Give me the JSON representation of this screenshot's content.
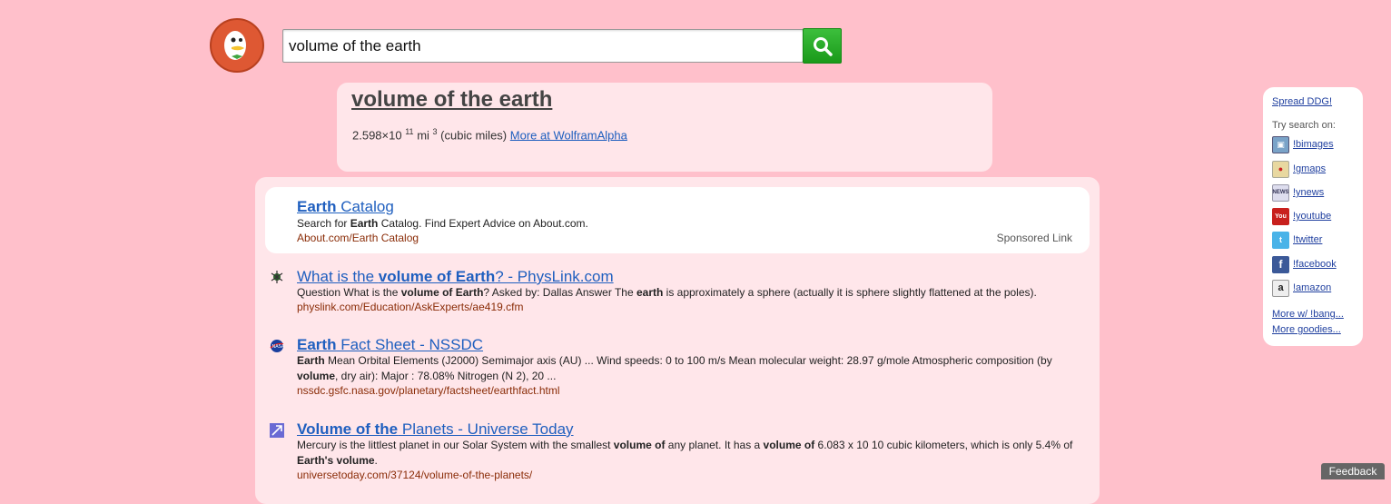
{
  "search": {
    "query": "volume of the earth"
  },
  "zero_click": {
    "title": "volume of the earth",
    "value_prefix": "2.598×10",
    "value_exp": "11",
    "unit": "mi",
    "unit_exp": "3",
    "unit_desc": "(cubic miles)",
    "more_link": "More at WolframAlpha"
  },
  "ad": {
    "title_bold": "Earth",
    "title_rest": " Catalog",
    "snippet_pre": "Search for ",
    "snippet_bold": "Earth",
    "snippet_post": " Catalog. Find Expert Advice on About.com.",
    "url": "About.com/Earth Catalog",
    "sponsored": "Sponsored Link"
  },
  "results": [
    {
      "title_pre": "What is the ",
      "title_bold": "volume of Earth",
      "title_post": "? - PhysLink.com",
      "snip": [
        {
          "t": "Question What is the "
        },
        {
          "b": "volume of Earth"
        },
        {
          "t": "? Asked by: Dallas Answer The "
        },
        {
          "b": "earth"
        },
        {
          "t": " is approximately a sphere (actually it is sphere slightly flattened at the poles)."
        }
      ],
      "url": "physlink.com/Education/AskExperts/ae419.cfm"
    },
    {
      "title_pre": "",
      "title_bold": "Earth",
      "title_post": " Fact Sheet - NSSDC",
      "snip": [
        {
          "b": "Earth"
        },
        {
          "t": " Mean Orbital Elements (J2000) Semimajor axis (AU) ... Wind speeds: 0 to 100 m/s Mean molecular weight: 28.97 g/mole Atmospheric composition (by "
        },
        {
          "b": "volume"
        },
        {
          "t": ", dry air): Major : 78.08% Nitrogen (N 2), 20 ..."
        }
      ],
      "url": "nssdc.gsfc.nasa.gov/planetary/factsheet/earthfact.html"
    },
    {
      "title_pre": "",
      "title_bold": "Volume of the",
      "title_post": " Planets - Universe Today",
      "snip": [
        {
          "t": "Mercury is the littlest planet in our Solar System with the smallest "
        },
        {
          "b": "volume of"
        },
        {
          "t": " any planet. It has a "
        },
        {
          "b": "volume of"
        },
        {
          "t": " 6.083 x 10 10 cubic kilometers, which is only 5.4% of "
        },
        {
          "b": "Earth's volume"
        },
        {
          "t": "."
        }
      ],
      "url": "universetoday.com/37124/volume-of-the-planets/"
    }
  ],
  "sidebar": {
    "spread": "Spread DDG!",
    "try_label": "Try search on:",
    "bangs": [
      {
        "label": "!bimages",
        "icon": "images-icon"
      },
      {
        "label": "!gmaps",
        "icon": "maps-icon"
      },
      {
        "label": "!ynews",
        "icon": "news-icon"
      },
      {
        "label": "!youtube",
        "icon": "youtube-icon"
      },
      {
        "label": "!twitter",
        "icon": "twitter-icon"
      },
      {
        "label": "!facebook",
        "icon": "facebook-icon"
      },
      {
        "label": "!amazon",
        "icon": "amazon-icon"
      }
    ],
    "more_bang": "More w/ !bang...",
    "more_goodies": "More goodies..."
  },
  "feedback": "Feedback"
}
